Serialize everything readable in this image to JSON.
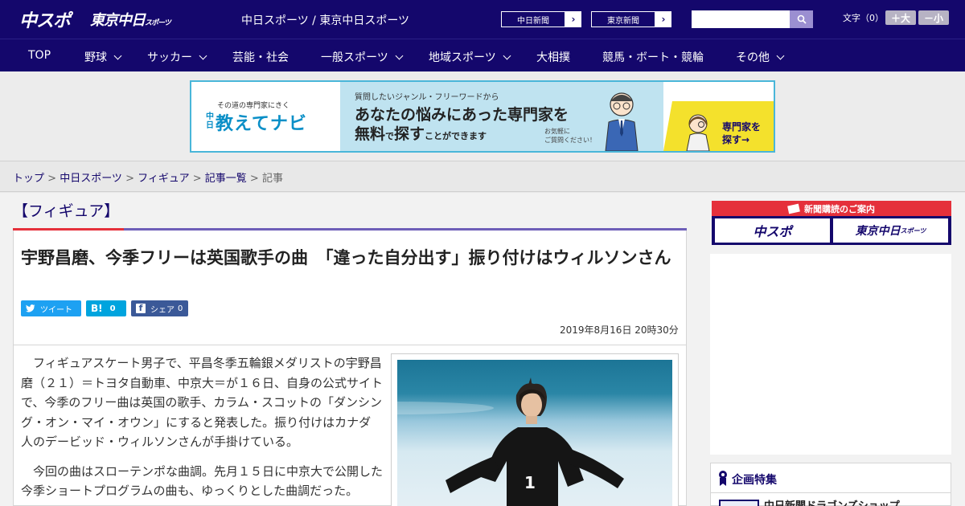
{
  "header": {
    "logo_chuspo": "中スポ",
    "logo_tokyo": "東京中日",
    "logo_tokyo_small": "スポーツ",
    "site_name": "中日スポーツ / 東京中日スポーツ",
    "paper_links": [
      {
        "label": "中日新聞"
      },
      {
        "label": "東京新聞"
      }
    ],
    "search_placeholder": "",
    "font_size_label": "文字（0）",
    "font_bigger": "＋大",
    "font_smaller": "－小"
  },
  "nav": {
    "items": [
      {
        "label": "TOP",
        "dropdown": false
      },
      {
        "label": "野球",
        "dropdown": true
      },
      {
        "label": "サッカー",
        "dropdown": true
      },
      {
        "label": "芸能・社会",
        "dropdown": false
      },
      {
        "label": "一般スポーツ",
        "dropdown": true
      },
      {
        "label": "地域スポーツ",
        "dropdown": true
      },
      {
        "label": "大相撲",
        "dropdown": false
      },
      {
        "label": "競馬・ボート・競輪",
        "dropdown": false
      },
      {
        "label": "その他",
        "dropdown": true
      }
    ]
  },
  "banner": {
    "tagline": "その道の専門家にきく",
    "brand_prefix": "中日",
    "brand": "教えてナビ",
    "question": "質問したいジャンル・フリーワードから",
    "headline1": "あなたの悩みにあった専門家を",
    "headline2_a": "無料",
    "headline2_b": "で",
    "headline2_c": "探す",
    "headline2_d": "ことができます",
    "note": "お気軽に\nご質問ください！",
    "cta_line1": "専門家を",
    "cta_line2": "探す→"
  },
  "breadcrumb": {
    "items": [
      "トップ",
      "中日スポーツ",
      "フィギュア",
      "記事一覧"
    ],
    "current": "記事",
    "separator": " > "
  },
  "article": {
    "category": "【フィギュア】",
    "headline": "宇野昌磨、今季フリーは英国歌手の曲　「違った自分出す」振り付けはウィルソンさん",
    "share": {
      "tweet": "ツイート",
      "hatena_label": "B!",
      "hatena_count": "0",
      "facebook_label": "シェア",
      "facebook_count": "0"
    },
    "date": "2019年8月16日 20時30分",
    "paragraphs": [
      "フィギュアスケート男子で、平昌冬季五輪銀メダリストの宇野昌磨（２１）＝トヨタ自動車、中京大＝が１６日、自身の公式サイトで、今季のフリー曲は英国の歌手、カラム・スコットの「ダンシング・オン・マイ・オウン」にすると発表した。振り付けはカナダ人のデービッド・ウィルソンさんが手掛けている。",
      "今回の曲はスローテンポな曲調。先月１５日に中京大で公開した今季ショートプログラムの曲も、ゆっくりとした曲調だった。"
    ],
    "photo_jersey_number": "1"
  },
  "sidebar": {
    "subscribe_title": "新聞購読のご案内",
    "subscribe_logos": [
      "中スポ",
      "東京中日"
    ],
    "subscribe_logo_small": "スポーツ",
    "feature_title": "企画特集",
    "feature_item": "中日新聞ドラゴンズショップ"
  },
  "colors": {
    "brand_navy": "#14076c",
    "accent_red": "#e5303b",
    "accent_purple": "#6e5fb8",
    "twitter": "#1da1f2",
    "hatena": "#00a4de",
    "facebook": "#3b5998"
  }
}
